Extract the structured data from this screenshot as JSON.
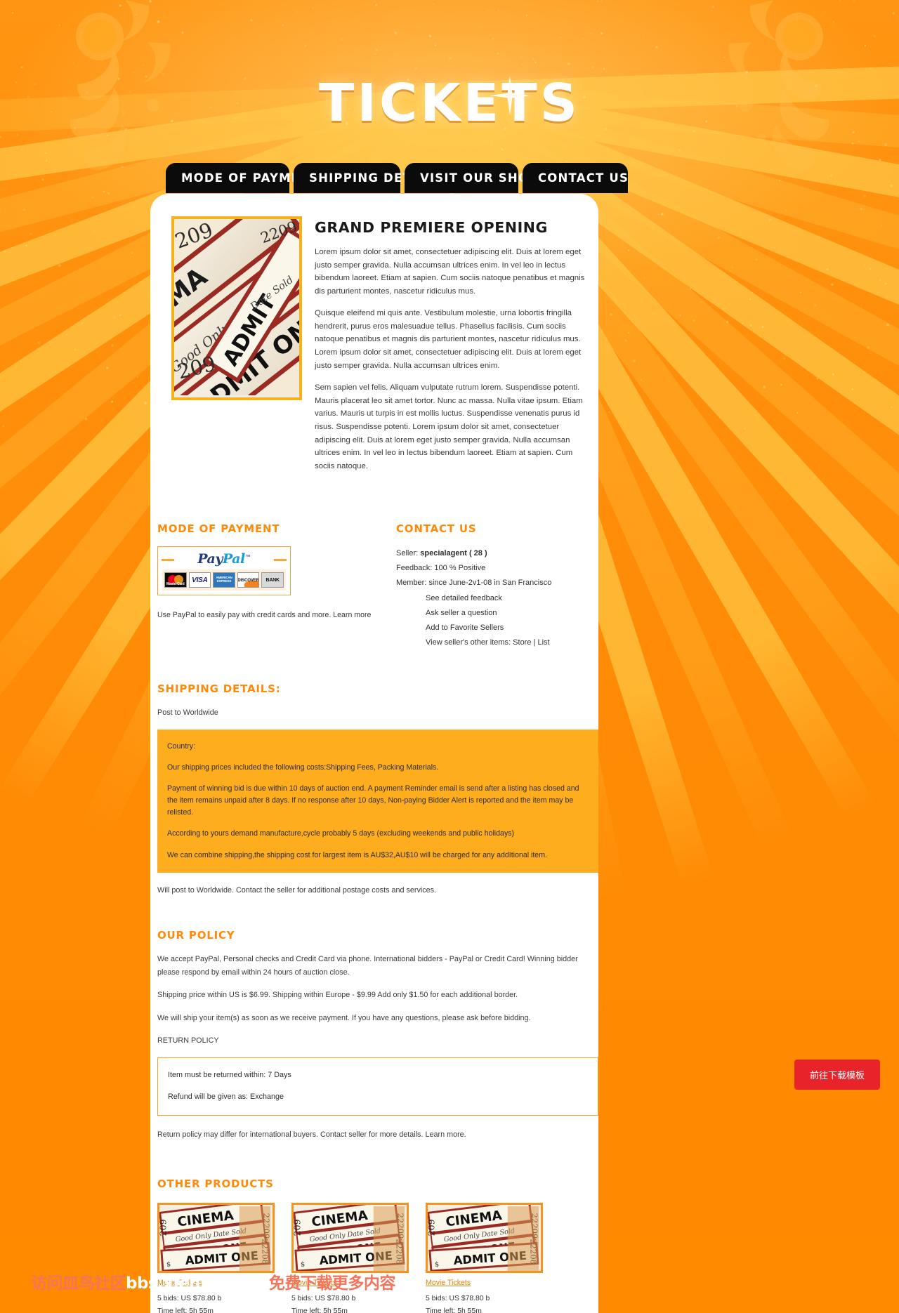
{
  "site": {
    "logo": "TICKETS",
    "accent_orange": "#FF8A0A",
    "bg_orange": "#FF9100",
    "nav_bg": "#0b0b0b"
  },
  "nav": {
    "items": [
      {
        "label": "MODE OF PAYMENT",
        "name": "nav-mode-of-payment"
      },
      {
        "label": "SHIPPING DETAILS",
        "name": "nav-shipping-details"
      },
      {
        "label": "VISIT OUR SHOP",
        "name": "nav-visit-our-shop"
      },
      {
        "label": "CONTACT US",
        "name": "nav-contact-us"
      }
    ]
  },
  "hero": {
    "image_alt": "cinema admit one tickets",
    "title": "GRAND PREMIERE OPENING",
    "paragraphs": [
      "Lorem ipsum dolor sit amet, consectetuer adipiscing elit. Duis at lorem eget justo semper gravida. Nulla accumsan ultrices enim. In vel leo in lectus bibendum laoreet. Etiam at sapien. Cum sociis natoque penatibus et magnis dis parturient montes, nascetur ridiculus mus.",
      "Quisque eleifend mi quis ante. Vestibulum molestie, urna lobortis fringilla hendrerit, purus eros malesuadue tellus. Phasellus facilisis. Cum sociis natoque penatibus et magnis dis parturient montes, nascetur ridiculus mus. Lorem ipsum dolor sit amet, consectetuer adipiscing elit. Duis at lorem eget justo semper gravida. Nulla accumsan ultrices enim.",
      "Sem sapien vel felis. Aliquam vulputate rutrum lorem. Suspendisse potenti. Mauris placerat leo sit amet tortor. Nunc ac massa. Nulla vitae ipsum. Etiam varius. Mauris ut turpis in est mollis luctus. Suspendisse venenatis purus id risus. Suspendisse potenti. Lorem ipsum dolor sit amet, consectetuer adipiscing elit. Duis at lorem eget justo semper gravida. Nulla accumsan ultrices enim. In vel leo in lectus bibendum laoreet. Etiam at sapien. Cum sociis natoque."
    ]
  },
  "payment": {
    "heading": "MODE OF PAYMENT",
    "paypal_word_1": "Pay",
    "paypal_word_2": "Pal",
    "paypal_tm": "™",
    "cards": [
      {
        "name": "mastercard-icon",
        "label": "MasterCard"
      },
      {
        "name": "visa-icon",
        "label": "VISA"
      },
      {
        "name": "amex-icon",
        "label": "AMERICAN EXPRESS"
      },
      {
        "name": "discover-icon",
        "label": "DISCOVER"
      },
      {
        "name": "bank-icon",
        "label": "BANK"
      }
    ],
    "note": "Use PayPal to easily pay with credit cards and more. Learn more"
  },
  "contact": {
    "heading": "CONTACT US",
    "seller_label": "Seller:",
    "seller_value": "specialagent ( 28 )",
    "feedback": "Feedback: 100 % Positive",
    "member": "Member: since June-2v1-08 in San Francisco",
    "links": [
      "See detailed feedback",
      "Ask seller a question",
      "Add to Favorite Sellers"
    ],
    "other_items_prefix": "View seller's other items:",
    "other_items_store": "Store",
    "other_items_sep": "|",
    "other_items_list": "List"
  },
  "shipping": {
    "heading": "SHIPPING DETAILS:",
    "post_to": "Post to Worldwide",
    "box": [
      "Country:",
      "Our shipping prices included the following costs:Shipping Fees, Packing Materials.",
      "Payment of winning bid is due within 10 days of auction end. A payment Reminder email is send after a listing has closed and the item remains unpaid after 8 days. If no response after 10 days, Non-paying Bidder Alert is reported and the item may be relisted.",
      "According to yours demand manufacture,cycle probably 5 days (excluding weekends and public holidays)",
      "We can combine shipping,the shipping cost for largest item is AU$32,AU$10 will be charged for any addItional item."
    ],
    "footer": "Will post to Worldwide. Contact the seller for additional postage costs and services."
  },
  "policy": {
    "heading": "OUR POLICY",
    "paragraphs": [
      "We accept PayPal, Personal checks and Credit Card via phone. International bidders - PayPal or Credit Card! Winning bidder please respond by email within 24 hours of auction close.",
      "Shipping price within US is $6.99. Shipping within Europe - $9.99 Add only $1.50 for each additional border.",
      "We will ship your item(s) as soon as we receive payment. If you have any questions, please ask before bidding."
    ],
    "return_title": "RETURN POLICY",
    "return_box": [
      "Item must be returned within: 7 Days",
      "Refund will be given as: Exchange"
    ],
    "return_footer": "Return policy may differ for international buyers. Contact seller for more details. Learn more."
  },
  "other_products": {
    "heading": "OTHER PRODUCTS",
    "items": [
      {
        "title": "Movie Tickets",
        "bids": "5 bids: US $78.80 b",
        "time": "Time left: 5h 55m"
      },
      {
        "title": "Movie Tickets",
        "bids": "5 bids: US $78.80 b",
        "time": "Time left: 5h 55m"
      },
      {
        "title": "Movie Tickets",
        "bids": "5 bids: US $78.80 b",
        "time": "Time left: 5h 55m"
      }
    ]
  },
  "download_button": {
    "label": "前往下载模板"
  },
  "watermark": {
    "part1": "访问皿鸟社区",
    "part2": "bbs.xienlao.com",
    "part3": "免费下载更多内容"
  }
}
